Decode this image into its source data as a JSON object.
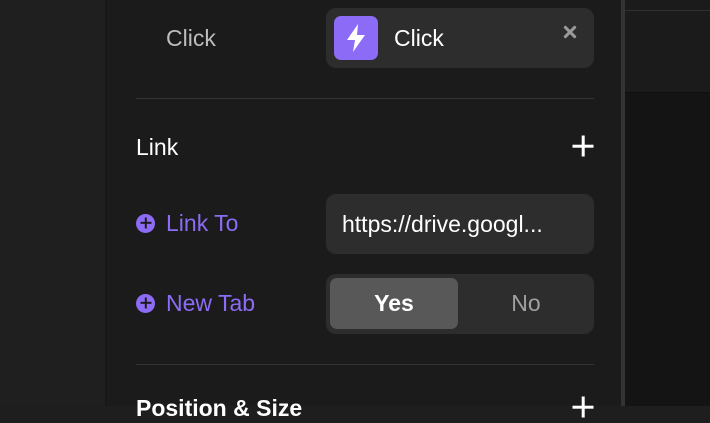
{
  "trigger": {
    "label": "Click",
    "value": "Click"
  },
  "link_section": {
    "title": "Link",
    "link_to": {
      "label": "Link To",
      "value": "https://drive.googl..."
    },
    "new_tab": {
      "label": "New Tab",
      "options": [
        "Yes",
        "No"
      ],
      "selected": "Yes"
    }
  },
  "next_section": {
    "title": "Position & Size"
  },
  "colors": {
    "accent": "#8c6cf6",
    "panel": "#1b1b1b",
    "field": "#2d2d2d"
  },
  "icons": {
    "trigger": "lightning-bolt-icon",
    "remove": "close-icon",
    "add": "plus-icon",
    "property": "plus-circle-icon"
  }
}
